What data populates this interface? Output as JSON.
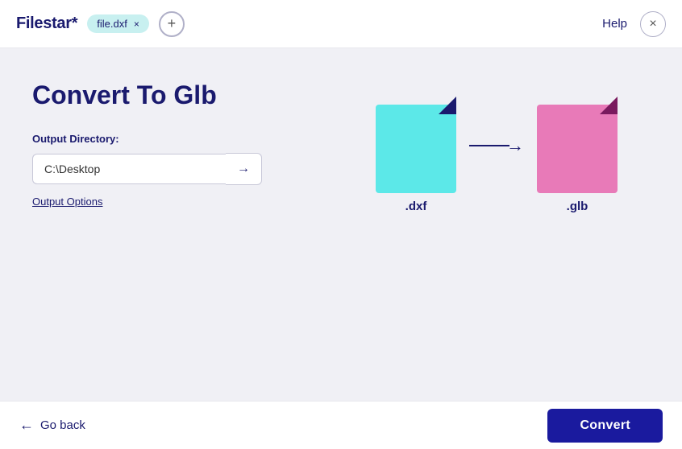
{
  "app": {
    "title": "Filestar*"
  },
  "header": {
    "file_tag_label": "file.dxf",
    "file_tag_close": "×",
    "add_file_label": "+",
    "help_label": "Help",
    "close_label": "×"
  },
  "main": {
    "page_title": "Convert To Glb",
    "output_directory_label": "Output Directory:",
    "output_directory_value": "C:\\Desktop",
    "output_directory_placeholder": "C:\\Desktop",
    "output_options_label": "Output Options",
    "arrow_button": "→",
    "source_ext": ".dxf",
    "target_ext": ".glb"
  },
  "footer": {
    "go_back_label": "Go back",
    "convert_label": "Convert"
  }
}
